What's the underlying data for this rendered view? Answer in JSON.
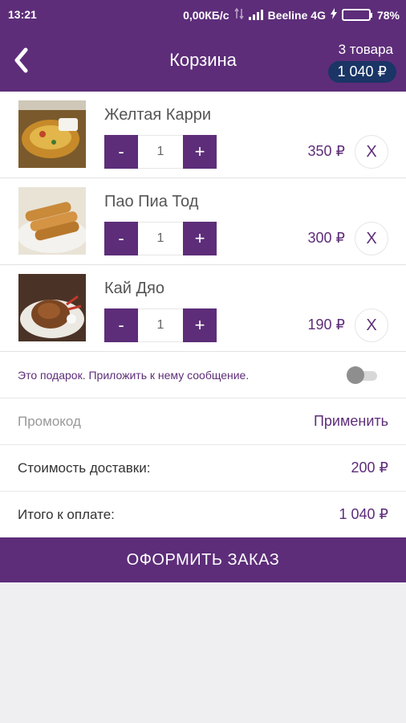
{
  "status_bar": {
    "time": "13:21",
    "network_speed": "0,00КБ/с",
    "carrier": "Beeline 4G",
    "battery": "78%",
    "battery_level": 0.78
  },
  "header": {
    "title": "Корзина",
    "items_count": "3 товара",
    "total": "1 040 ₽"
  },
  "cart": {
    "items": [
      {
        "name": "Желтая Карри",
        "quantity": "1",
        "price": "350 ₽",
        "minus": "-",
        "plus": "+",
        "remove": "X"
      },
      {
        "name": "Пао Пиа Тод",
        "quantity": "1",
        "price": "300 ₽",
        "minus": "-",
        "plus": "+",
        "remove": "X"
      },
      {
        "name": "Кай Дяо",
        "quantity": "1",
        "price": "190 ₽",
        "minus": "-",
        "plus": "+",
        "remove": "X"
      }
    ]
  },
  "gift": {
    "label": "Это подарок. Приложить к нему сообщение.",
    "enabled": false
  },
  "promo": {
    "placeholder": "Промокод",
    "value": "",
    "apply_label": "Применить"
  },
  "delivery": {
    "label": "Стоимость доставки:",
    "value": "200 ₽"
  },
  "total": {
    "label": "Итого к оплате:",
    "value": "1 040 ₽"
  },
  "checkout": {
    "label": "ОФОРМИТЬ ЗАКАЗ"
  },
  "colors": {
    "primary": "#5d2d79",
    "pill": "#1a3566",
    "background": "#efeef0",
    "battery": "#52d657"
  },
  "icons": {
    "back": "chevron-left-icon",
    "data_activity": "arrows-updown-icon",
    "signal": "signal-bars-icon",
    "charging": "lightning-icon",
    "battery": "battery-icon"
  }
}
